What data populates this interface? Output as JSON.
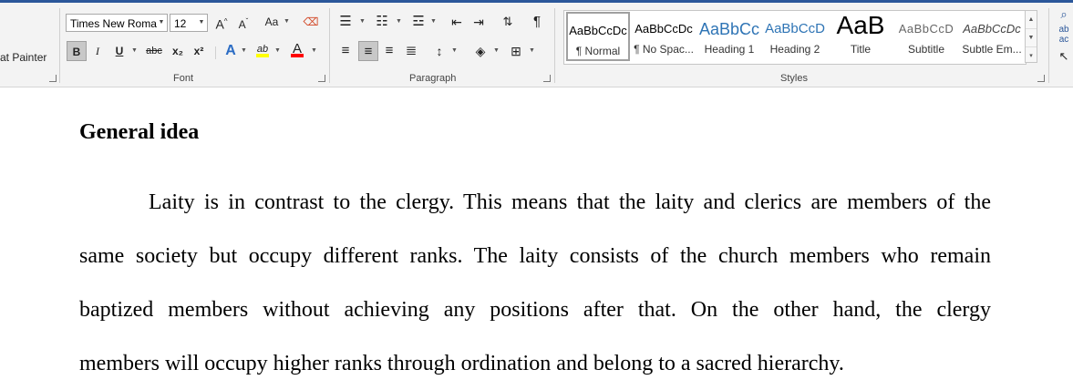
{
  "clipboard": {
    "format_painter_label": "at Painter"
  },
  "font_group": {
    "label": "Font",
    "font_name": "Times New Roma",
    "font_size": "12",
    "grow": "A",
    "shrink": "A",
    "case": "Aa",
    "bold": "B",
    "italic": "I",
    "underline": "U",
    "strike": "abc",
    "subscript": "x₂",
    "superscript": "x²",
    "text_effects": "A",
    "highlight": "ab",
    "font_color": "A"
  },
  "paragraph_group": {
    "label": "Paragraph"
  },
  "styles_group": {
    "label": "Styles",
    "items": [
      {
        "preview": "AaBbCcDc",
        "name": "¶ Normal"
      },
      {
        "preview": "AaBbCcDc",
        "name": "¶ No Spac..."
      },
      {
        "preview": "AaBbCc",
        "name": "Heading 1"
      },
      {
        "preview": "AaBbCcD",
        "name": "Heading 2"
      },
      {
        "preview": "AaB",
        "name": "Title"
      },
      {
        "preview": "AaBbCcD",
        "name": "Subtitle"
      },
      {
        "preview": "AaBbCcDc",
        "name": "Subtle Em..."
      }
    ]
  },
  "document": {
    "heading": "General idea",
    "lines": [
      "Laity is in contrast to the clergy. This means that the laity and clerics are members of the",
      "same society but occupy different ranks. The laity consists of the church members who remain",
      "baptized members without achieving any positions after that. On the other hand, the clergy",
      "members will occupy higher ranks through ordination and belong to a sacred hierarchy."
    ]
  },
  "colors": {
    "accent": "#2b579a",
    "heading1": "#2e74b5",
    "highlight": "#ffff00",
    "font_color_bar": "#ff0000"
  }
}
